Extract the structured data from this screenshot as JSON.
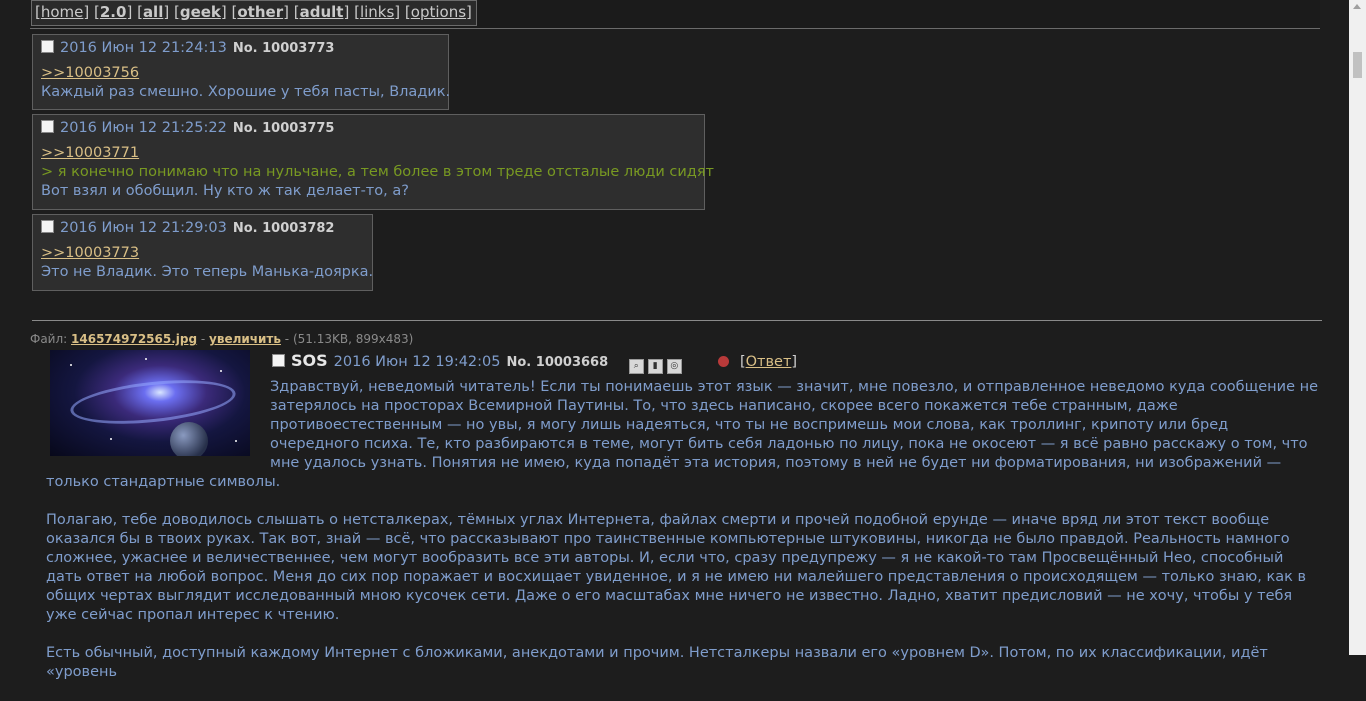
{
  "nav": [
    {
      "label": "home",
      "bold": false
    },
    {
      "label": "2.0",
      "bold": true
    },
    {
      "label": "all",
      "bold": true
    },
    {
      "label": "geek",
      "bold": true
    },
    {
      "label": "other",
      "bold": true
    },
    {
      "label": "adult",
      "bold": true
    },
    {
      "label": "links",
      "bold": false
    },
    {
      "label": "options",
      "bold": false
    }
  ],
  "replies": [
    {
      "date": "2016 Июн 12 21:24:13",
      "no": "No. 10003773",
      "ref": ">>10003756",
      "lines": [
        {
          "text": "Каждый раз смешно. Хорошие у тебя пасты, Владик.",
          "quote": false
        }
      ]
    },
    {
      "date": "2016 Июн 12 21:25:22",
      "no": "No. 10003775",
      "ref": ">>10003771",
      "lines": [
        {
          "text": "> я конечно понимаю что на нульчане, а тем более в этом треде отсталые люди сидят",
          "quote": true
        },
        {
          "text": "Вот взял и обобщил. Ну кто ж так делает-то, а?",
          "quote": false
        }
      ]
    },
    {
      "date": "2016 Июн 12 21:29:03",
      "no": "No. 10003782",
      "ref": ">>10003773",
      "lines": [
        {
          "text": "Это не Владик. Это теперь Манька-доярка.",
          "quote": false
        }
      ]
    }
  ],
  "op": {
    "file_prefix": "Файл: ",
    "file_name": "146574972565.jpg",
    "file_sep": " - ",
    "enlarge": "увеличить",
    "file_meta": " - (51.13KB, 899x483)",
    "subject": "SOS",
    "date": "2016 Июн 12 19:42:05",
    "no": "No. 10003668",
    "reply_open": "[",
    "reply_label": "Ответ",
    "reply_close": "]",
    "paragraphs": [
      "Здравствуй, неведомый читатель! Если ты понимаешь этот язык — значит, мне повезло, и отправленное неведомо куда сообщение не затерялось на просторах Всемирной Паутины. То, что здесь написано, скорее всего покажется тебе странным, даже противоестественным — но увы, я могу лишь надеяться, что ты не воспримешь мои слова, как троллинг, крипоту или бред очередного психа. Те, кто разбираются в теме, могут бить себя ладонью по лицу, пока не окосеют — я всё равно расскажу о том, что мне удалось узнать. Понятия не имею, куда попадёт эта история, поэтому в ней не будет ни форматирования, ни изображений — только стандартные символы.",
      "Полагаю, тебе доводилось слышать о нетсталкерах, тёмных углах Интернета, файлах смерти и прочей подобной ерунде — иначе вряд ли этот текст вообще оказался бы в твоих руках. Так вот, знай — всё, что рассказывают про таинственные компьютерные штуковины, никогда не было правдой. Реальность намного сложнее, ужаснее и величественнее, чем могут вообразить все эти авторы. И, если что, сразу предупрежу — я не какой-то там Просвещённый Нео, способный дать ответ на любой вопрос. Меня до сих пор поражает и восхищает увиденное, и я не имею ни малейшего представления о происходящем — только знаю, как в общих чертах выглядит исследованный мною кусочек сети. Даже о его масштабах мне ничего не известно. Ладно, хватит предисловий — не хочу, чтобы у тебя уже сейчас пропал интерес к чтению.",
      "Есть обычный, доступный каждому Интернет с бложиками, анекдотами и прочим. Нетсталкеры назвали его «уровнем D». Потом, по их классификации, идёт «уровень"
    ]
  },
  "colors": {
    "background": "#1d1d1d",
    "post_bg": "#2e2e2e",
    "text": "#7f9dcc",
    "link": "#d9bf86",
    "quote": "#789922"
  }
}
